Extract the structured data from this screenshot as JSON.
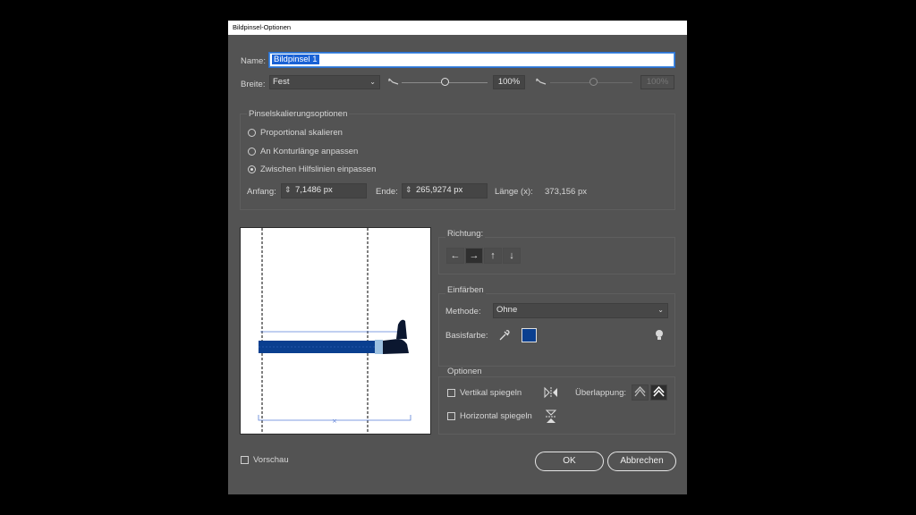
{
  "dialog": {
    "title": "Bildpinsel-Optionen",
    "name_label": "Name:",
    "name_value": "Bildpinsel 1",
    "width_label": "Breite:",
    "width_select": "Fest",
    "width_slider_value": "100%",
    "width_slider2_value": "100%",
    "scaling": {
      "title": "Pinselskalierungsoptionen",
      "options": [
        "Proportional skalieren",
        "An Konturlänge anpassen",
        "Zwischen Hilfslinien einpassen"
      ],
      "selected_index": 2,
      "start_label": "Anfang:",
      "start_value": "7,1486 px",
      "end_label": "Ende:",
      "end_value": "265,9274 px",
      "length_label": "Länge (x):",
      "length_value": "373,156 px"
    },
    "direction": {
      "title": "Richtung:",
      "buttons": [
        "←",
        "→",
        "↑",
        "↓"
      ],
      "active_index": 1
    },
    "colorize": {
      "title": "Einfärben",
      "method_label": "Methode:",
      "method_value": "Ohne",
      "base_color_label": "Basisfarbe:",
      "base_color": "#0a3f8f"
    },
    "options": {
      "title": "Optionen",
      "flip_vertical": "Vertikal spiegeln",
      "flip_horizontal": "Horizontal spiegeln",
      "overlap_label": "Überlappung:"
    },
    "preview_label": "Vorschau",
    "ok_label": "OK",
    "cancel_label": "Abbrechen",
    "colors": {
      "panel": "#535353",
      "accent": "#1a62d6",
      "brush_blue": "#0a3f8f"
    }
  }
}
